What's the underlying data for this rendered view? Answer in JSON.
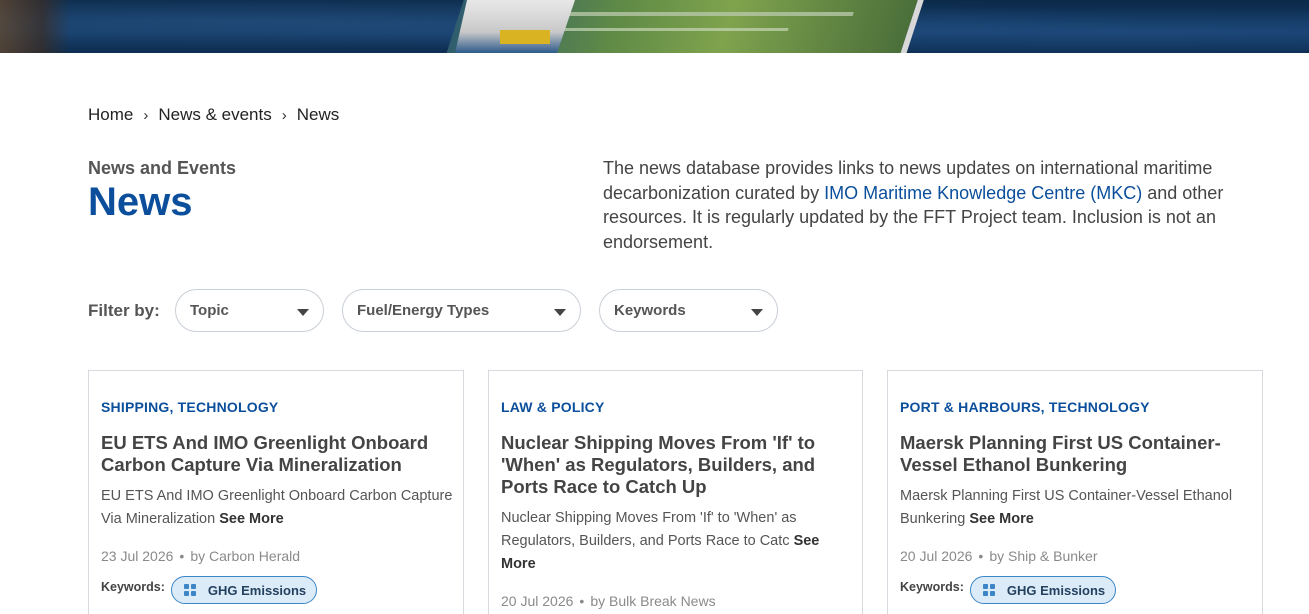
{
  "breadcrumb": {
    "items": [
      "Home",
      "News & events",
      "News"
    ],
    "separator": "›"
  },
  "header": {
    "eyebrow": "News and Events",
    "title": "News"
  },
  "intro": {
    "text_before": "The news database provides links to news updates on international maritime decarbonization curated by ",
    "link": "IMO Maritime Knowledge Centre (MKC)",
    "text_after": " and other resources. It is regularly updated by the FFT Project team. Inclusion is not an endorsement."
  },
  "filters": {
    "label": "Filter by:",
    "topic": "Topic",
    "fuel": "Fuel/Energy Types",
    "keywords": "Keywords"
  },
  "cards": [
    {
      "category": "SHIPPING, TECHNOLOGY",
      "title": "EU ETS And IMO Greenlight Onboard Carbon Capture Via Mineralization",
      "description": "EU ETS And IMO Greenlight Onboard Carbon Capture Via Mineralization",
      "see_more": "See More",
      "date": "23 Jul 2026",
      "source": "by Carbon Herald",
      "keywords_label": "Keywords:",
      "keyword": "GHG Emissions"
    },
    {
      "category": "LAW & POLICY",
      "title": "Nuclear Shipping Moves From 'If' to 'When' as Regulators, Builders, and Ports Race to Catch Up",
      "description": "Nuclear Shipping Moves From 'If' to 'When' as Regulators, Builders, and Ports Race to Catc",
      "see_more": "See More",
      "date": "20 Jul 2026",
      "source": "by Bulk Break News"
    },
    {
      "category": "PORT & HARBOURS, TECHNOLOGY",
      "title": "Maersk Planning First US Container-Vessel Ethanol Bunkering",
      "description": "Maersk Planning First US Container-Vessel Ethanol Bunkering",
      "see_more": "See More",
      "date": "20 Jul 2026",
      "source": "by Ship & Bunker",
      "keywords_label": "Keywords:",
      "keyword": "GHG Emissions"
    }
  ],
  "meta_dot": "•",
  "colors": {
    "brand": "#0b4f9c",
    "chip_bg": "#dcebf8",
    "chip_border": "#3c86c8"
  },
  "icons": [
    "chevron-right-icon",
    "dropdown-caret-icon",
    "grid-icon"
  ]
}
